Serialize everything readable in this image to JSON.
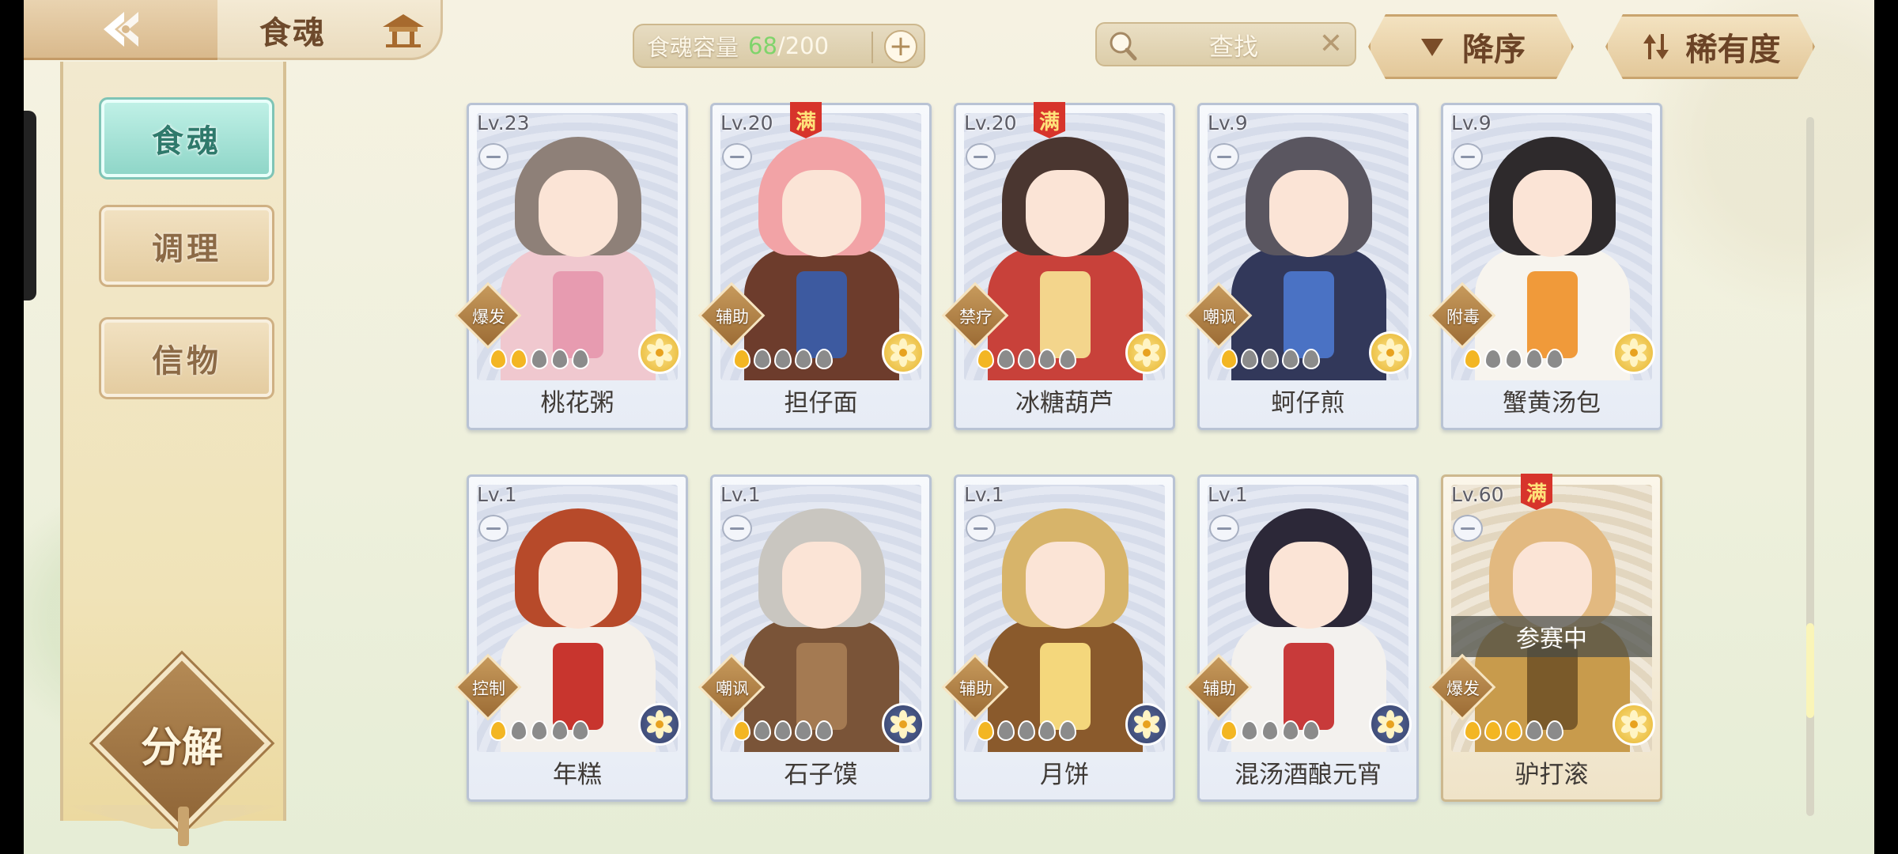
{
  "header": {
    "title": "食魂",
    "capacity_label": "食魂容量",
    "capacity_current": "68",
    "capacity_max": "/200",
    "capacity_add": "+",
    "search_label": "查找",
    "search_clear": "✕",
    "sort_order_label": "降序",
    "sort_key_label": "稀有度"
  },
  "sidebar": {
    "items": [
      {
        "label": "食魂",
        "active": true
      },
      {
        "label": "调理",
        "active": false
      },
      {
        "label": "信物",
        "active": false
      }
    ],
    "decompose_label": "分解"
  },
  "cards": [
    {
      "level": "Lv.23",
      "name": "桃花粥",
      "role": "爆发",
      "stars": 2,
      "full": false,
      "full_label": "",
      "rarity": "gold",
      "status": "",
      "hair": "#8e8078",
      "body": "#f0c8cf",
      "accent": "#e79bb0"
    },
    {
      "level": "Lv.20",
      "name": "担仔面",
      "role": "辅助",
      "stars": 1,
      "full": true,
      "full_label": "满",
      "rarity": "gold",
      "status": "",
      "hair": "#f2a3a6",
      "body": "#6d3c2c",
      "accent": "#3d5aa0"
    },
    {
      "level": "Lv.20",
      "name": "冰糖葫芦",
      "role": "禁疗",
      "stars": 1,
      "full": true,
      "full_label": "满",
      "rarity": "gold",
      "status": "",
      "hair": "#4a3630",
      "body": "#c8413a",
      "accent": "#f3d58c"
    },
    {
      "level": "Lv.9",
      "name": "蚵仔煎",
      "role": "嘲讽",
      "stars": 1,
      "full": false,
      "full_label": "",
      "rarity": "gold",
      "status": "",
      "hair": "#5a5660",
      "body": "#32385a",
      "accent": "#4a72c4"
    },
    {
      "level": "Lv.9",
      "name": "蟹黄汤包",
      "role": "附毒",
      "stars": 1,
      "full": false,
      "full_label": "",
      "rarity": "gold",
      "status": "",
      "hair": "#2e2a2c",
      "body": "#f7f4ee",
      "accent": "#f09a3a"
    },
    {
      "level": "Lv.1",
      "name": "年糕",
      "role": "控制",
      "stars": 1,
      "full": false,
      "full_label": "",
      "rarity": "blue",
      "status": "",
      "hair": "#b74a2a",
      "body": "#f4f0ea",
      "accent": "#c8352e"
    },
    {
      "level": "Lv.1",
      "name": "石子馍",
      "role": "嘲讽",
      "stars": 1,
      "full": false,
      "full_label": "",
      "rarity": "blue",
      "status": "",
      "hair": "#c9c6c0",
      "body": "#7a5438",
      "accent": "#a47a52"
    },
    {
      "level": "Lv.1",
      "name": "月饼",
      "role": "辅助",
      "stars": 1,
      "full": false,
      "full_label": "",
      "rarity": "blue",
      "status": "",
      "hair": "#d7b46a",
      "body": "#8a5a2c",
      "accent": "#f4d77c"
    },
    {
      "level": "Lv.1",
      "name": "混汤酒酿元宵",
      "role": "辅助",
      "stars": 1,
      "full": false,
      "full_label": "",
      "rarity": "blue",
      "status": "",
      "hair": "#2c2838",
      "body": "#f3f1ee",
      "accent": "#c83a3a"
    },
    {
      "level": "Lv.60",
      "name": "驴打滚",
      "role": "爆发",
      "stars": 3,
      "full": true,
      "full_label": "满",
      "rarity": "gold",
      "status": "参赛中",
      "hair": "#e2b980",
      "body": "#c89b4c",
      "accent": "#7a5a2a"
    }
  ],
  "colors": {
    "accent_teal": "#8fd6c8",
    "tan": "#c9a46e",
    "capacity_green": "#7fd46b"
  },
  "icons": [
    "back-arrow-icon",
    "home-pavilion-icon",
    "plus-icon",
    "search-icon",
    "close-icon",
    "triangle-down-icon",
    "sort-arrows-icon",
    "dish-icon",
    "flame-icon",
    "flower-rarity-icon"
  ]
}
